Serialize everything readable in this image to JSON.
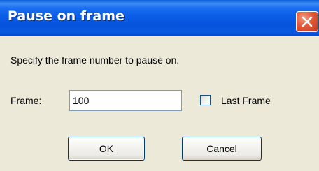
{
  "dialog": {
    "title": "Pause on frame",
    "prompt": "Specify the frame number to pause on.",
    "frame_label": "Frame:",
    "frame_value": "100",
    "last_frame_label": "Last Frame",
    "last_frame_checked": false,
    "ok_label": "OK",
    "cancel_label": "Cancel",
    "close_icon": "close-icon"
  },
  "colors": {
    "titlebar": "#0653dc",
    "close_button": "#e2593a",
    "window_bg": "#ece9d8"
  }
}
